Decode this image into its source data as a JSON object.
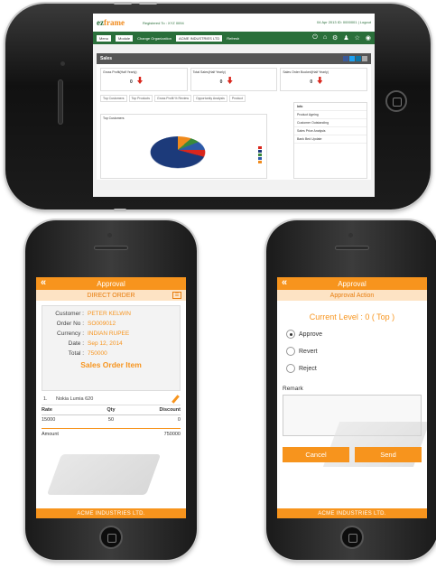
{
  "dashboard": {
    "logo_main": "ez",
    "logo_rest": "frame",
    "registered_to": "Registered To : XYZ 0094",
    "date_info": "04 Apr 2013  ID: 0000001 | Logout",
    "nav": {
      "menu": "Menu",
      "module": "Module",
      "change_org_label": "Change Organization",
      "org_value": "ACME INDUSTRIES LTD",
      "refresh": "Refresh"
    },
    "section_title": "Sales",
    "kpis": [
      {
        "label": "Gross Profit(Half Yearly)",
        "value": "0"
      },
      {
        "label": "Total Sales(Half Yearly)",
        "value": "0"
      },
      {
        "label": "Sales Order Booked(Half Yearly)",
        "value": "0"
      }
    ],
    "tabs": [
      "Top Customers",
      "Top Products",
      "Gross Profit % Review",
      "Opportunity Analysis",
      "Product"
    ],
    "chart_title": "Top Customers",
    "side_panel_title": "Info",
    "side_links": [
      "Product Ageing",
      "Customer Outstanding",
      "Sales Price Analysis",
      "Bank Bed Update"
    ]
  },
  "order_screen": {
    "title": "Approval",
    "subtitle": "DIRECT ORDER",
    "fields": [
      {
        "label": "Customer :",
        "value": "PETER KELWIN"
      },
      {
        "label": "Order No :",
        "value": "SO009012"
      },
      {
        "label": "Currency :",
        "value": "INDIAN RUPEE"
      },
      {
        "label": "Date :",
        "value": "Sep 12, 2014"
      },
      {
        "label": "Total :",
        "value": "750000"
      }
    ],
    "items_heading": "Sales Order Item",
    "item_index": "1.",
    "item_name": "Nokia Lumia 620",
    "grid_headers": [
      "Rate",
      "Qty",
      "Discount"
    ],
    "grid_values": [
      "15000",
      "50",
      "0"
    ],
    "amount_label": "Amount",
    "amount_value": "750000",
    "footer": "ACME INDUSTRIES LTD."
  },
  "action_screen": {
    "title": "Approval",
    "subtitle": "Approval Action",
    "level": "Current Level : 0 ( Top )",
    "options": [
      "Approve",
      "Revert",
      "Reject"
    ],
    "selected": "Approve",
    "remark_label": "Remark",
    "cancel": "Cancel",
    "send": "Send",
    "footer": "ACME INDUSTRIES LTD."
  },
  "colors": {
    "accent": "#f7941d",
    "brand_green": "#2a6f3a"
  }
}
